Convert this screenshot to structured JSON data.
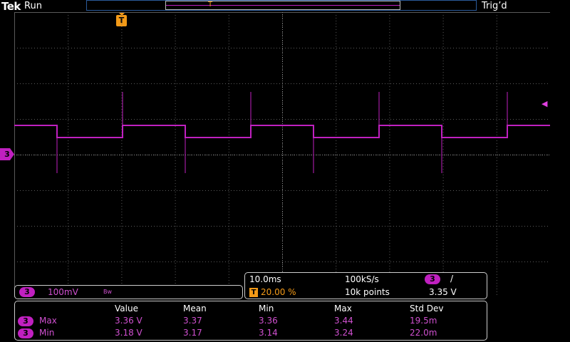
{
  "topbar": {
    "brand": "Tek",
    "run_state": "Run",
    "trigger_status": "Trig’d"
  },
  "trigger_marker": {
    "label": "T"
  },
  "channel_marker": {
    "label": "3"
  },
  "channel_panel": {
    "channel": "3",
    "volts_per_div": "100mV",
    "bw_label": "Bw"
  },
  "timebase": {
    "time_per_div": "10.0ms",
    "sample_rate": "100kS/s",
    "trigger_channel": "3",
    "trigger_slope_glyph": "/",
    "trigger_position_icon": "T",
    "trigger_position": "20.00 %",
    "record_length": "10k points",
    "trigger_level": "3.35 V"
  },
  "measurements": {
    "headers": [
      "Value",
      "Mean",
      "Min",
      "Max",
      "Std Dev"
    ],
    "rows": [
      {
        "channel": "3",
        "name": "Max",
        "values": [
          "3.36 V",
          "3.37",
          "3.36",
          "3.44",
          "19.5m"
        ]
      },
      {
        "channel": "3",
        "name": "Min",
        "values": [
          "3.18 V",
          "3.17",
          "3.14",
          "3.24",
          "22.0m"
        ]
      }
    ]
  },
  "colors": {
    "channel3": "#c020c0",
    "trigger": "#f39a18",
    "grid": "#5a5a5a",
    "background": "#000000"
  }
}
